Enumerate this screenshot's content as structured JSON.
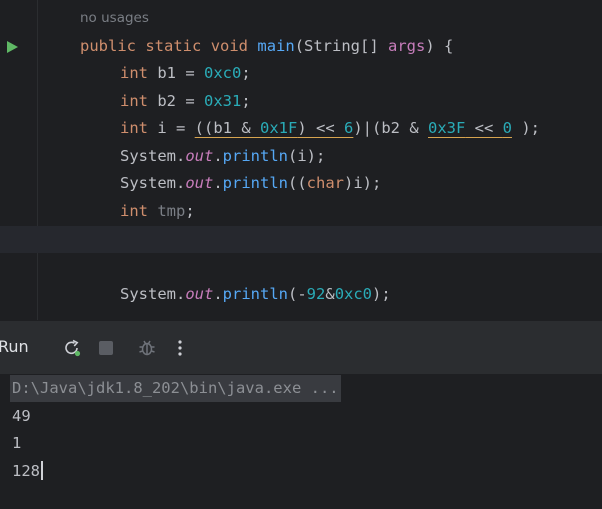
{
  "editor": {
    "inlay_hint": "no usages",
    "line1": {
      "kw1": "public",
      "kw2": "static",
      "kw3": "void",
      "method": "main",
      "rest1": "(String[] ",
      "param": "args",
      "rest2": ") {"
    },
    "line2": {
      "kw": "int",
      "rest": " b1 = ",
      "num": "0xc0",
      "end": ";"
    },
    "line3": {
      "kw": "int",
      "rest": " b2 = ",
      "num": "0x31",
      "end": ";"
    },
    "line4": {
      "kw": "int",
      "p1": " i = ",
      "u1": "((b1 & ",
      "n1": "0x1F",
      "u2": ") << ",
      "n2": "6",
      "p2": ")|(b2 & ",
      "n3": "0x3F",
      "u3": " << ",
      "n4": "0",
      "p3": " );"
    },
    "line5": {
      "p1": "System.",
      "field": "out",
      "p2": ".",
      "method": "println",
      "p3": "(i);"
    },
    "line6": {
      "p1": "System.",
      "field": "out",
      "p2": ".",
      "method": "println",
      "p3": "((",
      "kw": "char",
      "p4": ")i);"
    },
    "line7": {
      "kw": "int",
      "sp": " ",
      "var": "tmp",
      "end": ";"
    },
    "line8": {
      "p1": "System.",
      "field": "out",
      "p2": ".",
      "method": "println",
      "p3": "(-",
      "n1": "92",
      "p4": "&",
      "n2": "0xc0",
      "p5": ");"
    }
  },
  "tool_window": {
    "title": "Run",
    "icons": [
      "rerun-icon",
      "stop-icon",
      "debug-icon",
      "more-icon"
    ]
  },
  "console": {
    "command": "D:\\Java\\jdk1.8_202\\bin\\java.exe ...",
    "output": [
      "49",
      "1",
      "128"
    ]
  },
  "colors": {
    "background": "#1e1f22",
    "keyword": "#cf8e6d",
    "number": "#2aacb8",
    "method": "#56a8f5",
    "field": "#c77dbb",
    "run_green": "#5fb865"
  }
}
